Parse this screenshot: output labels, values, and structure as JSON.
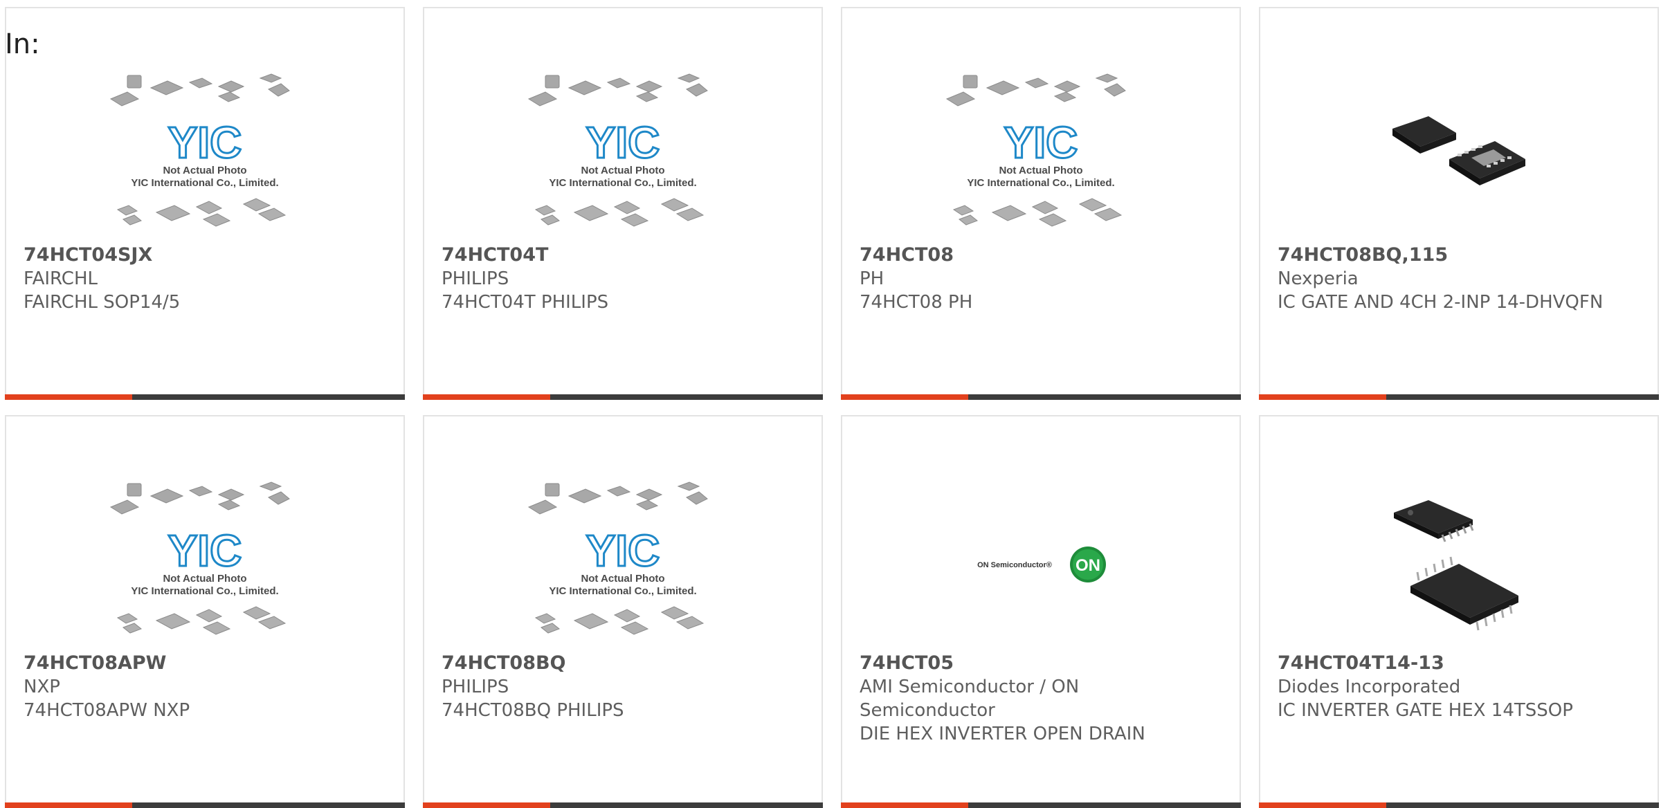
{
  "filter": {
    "label": "In:"
  },
  "products": [
    {
      "part_no": "74HCT04SJX",
      "maker": "FAIRCHL",
      "desc": "FAIRCHL SOP14/5",
      "image": "placeholder"
    },
    {
      "part_no": "74HCT04T",
      "maker": "PHILIPS",
      "desc": "74HCT04T PHILIPS",
      "image": "placeholder"
    },
    {
      "part_no": "74HCT08",
      "maker": "PH",
      "desc": "74HCT08 PH",
      "image": "placeholder"
    },
    {
      "part_no": "74HCT08BQ,115",
      "maker": "Nexperia",
      "desc": "IC GATE AND 4CH 2-INP 14-DHVQFN",
      "image": "dhvqfn-chip"
    },
    {
      "part_no": "74HCT08APW",
      "maker": "NXP",
      "desc": "74HCT08APW NXP",
      "image": "placeholder"
    },
    {
      "part_no": "74HCT08BQ",
      "maker": "PHILIPS",
      "desc": "74HCT08BQ PHILIPS",
      "image": "placeholder"
    },
    {
      "part_no": "74HCT05",
      "maker": "AMI Semiconductor / ON Semiconductor",
      "desc": "DIE HEX INVERTER OPEN DRAIN",
      "image": "on-semi-logo"
    },
    {
      "part_no": "74HCT04T14-13",
      "maker": "Diodes Incorporated",
      "desc": "IC INVERTER GATE HEX 14TSSOP",
      "image": "tssop-chip"
    }
  ],
  "placeholder": {
    "logo_text": "YIC",
    "line1": "Not Actual Photo",
    "line2": "YIC International Co., Limited."
  },
  "on_logo": {
    "wordmark": "ON Semiconductor®",
    "badge": "ON"
  },
  "colors": {
    "accent": "#e2411d",
    "bar": "#3c3c3c",
    "logo_blue": "#1e88c8"
  }
}
